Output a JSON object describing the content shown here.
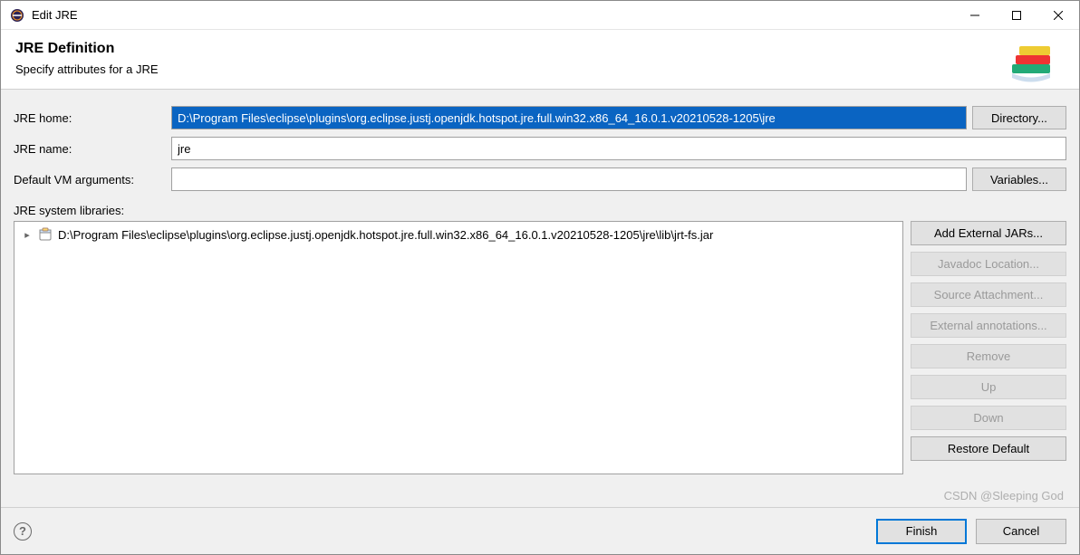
{
  "window": {
    "title": "Edit JRE"
  },
  "header": {
    "title": "JRE Definition",
    "subtitle": "Specify attributes for a JRE"
  },
  "form": {
    "jre_home_label": "JRE home:",
    "jre_home_value": "D:\\Program Files\\eclipse\\plugins\\org.eclipse.justj.openjdk.hotspot.jre.full.win32.x86_64_16.0.1.v20210528-1205\\jre",
    "directory_btn": "Directory...",
    "jre_name_label": "JRE name:",
    "jre_name_value": "jre",
    "vm_args_label": "Default VM arguments:",
    "vm_args_value": "",
    "variables_btn": "Variables...",
    "sys_lib_label": "JRE system libraries:"
  },
  "tree": {
    "items": [
      {
        "label": "D:\\Program Files\\eclipse\\plugins\\org.eclipse.justj.openjdk.hotspot.jre.full.win32.x86_64_16.0.1.v20210528-1205\\jre\\lib\\jrt-fs.jar"
      }
    ]
  },
  "buttons": {
    "add_external": "Add External JARs...",
    "javadoc": "Javadoc Location...",
    "source": "Source Attachment...",
    "ext_annot": "External annotations...",
    "remove": "Remove",
    "up": "Up",
    "down": "Down",
    "restore": "Restore Default"
  },
  "dialog": {
    "finish": "Finish",
    "cancel": "Cancel"
  },
  "watermark": "CSDN @Sleeping God"
}
